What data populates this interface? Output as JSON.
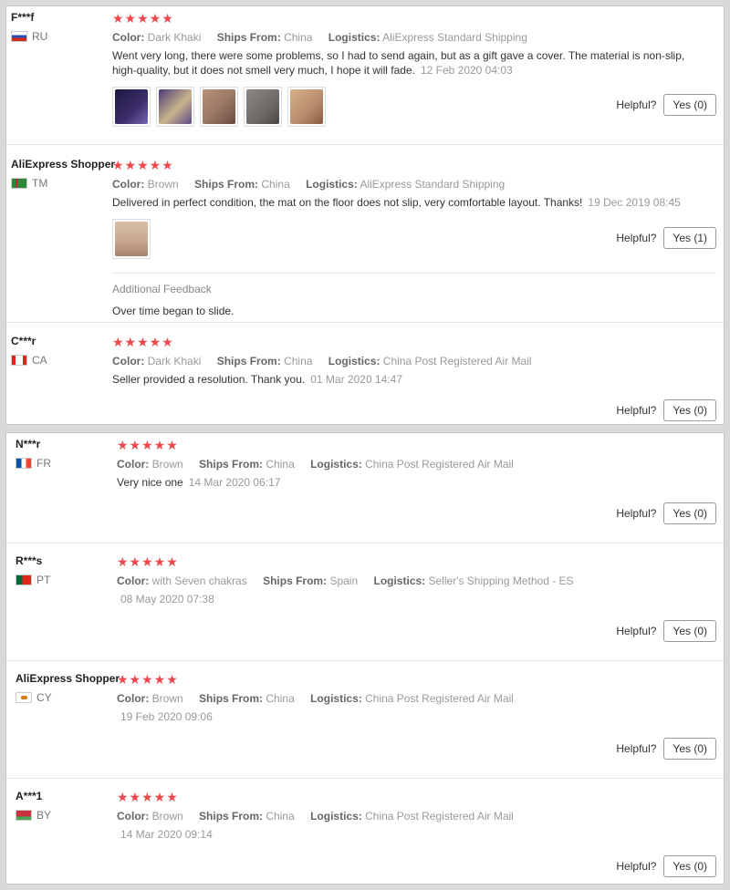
{
  "helpful_label": "Helpful?",
  "stars_text": "★★★★★",
  "labels": {
    "color": "Color:",
    "ships": "Ships From:",
    "logistics": "Logistics:"
  },
  "additional_feedback_title": "Additional Feedback",
  "reviews": [
    {
      "user": "F***f",
      "country": "RU",
      "flag": "russia",
      "color": "Dark Khaki",
      "ships_from": "China",
      "logistics": "AliExpress Standard Shipping",
      "text": "Went very long, there were some problems, so I had to send again, but as a gift gave a cover. The material is non-slip, high-quality, but it does not smell very much, I hope it will fade.",
      "date": "12 Feb 2020 04:03",
      "helpful": "Yes (0)",
      "photos": [
        "#3b2d6b",
        "#5b4a8a",
        "#9b7a66",
        "#6e6a66",
        "#b58a6a"
      ]
    },
    {
      "user": "AliExpress Shopper",
      "country": "TM",
      "flag": "turkmenistan",
      "color": "Brown",
      "ships_from": "China",
      "logistics": "AliExpress Standard Shipping",
      "text": "Delivered in perfect condition, the mat on the floor does not slip, very comfortable layout. Thanks!",
      "date": "19 Dec 2019 08:45",
      "helpful": "Yes (1)",
      "photos": [
        "#c7a58c"
      ],
      "additional_feedback": "Over time began to slide."
    },
    {
      "user": "C***r",
      "country": "CA",
      "flag": "canada",
      "color": "Dark Khaki",
      "ships_from": "China",
      "logistics": "China Post Registered Air Mail",
      "text": "Seller provided a resolution. Thank you.",
      "date": "01 Mar 2020 14:47",
      "helpful": "Yes (0)"
    },
    {
      "user": "N***r",
      "country": "FR",
      "flag": "france",
      "color": "Brown",
      "ships_from": "China",
      "logistics": "China Post Registered Air Mail",
      "text": "Very nice one",
      "date": "14 Mar 2020 06:17",
      "helpful": "Yes (0)"
    },
    {
      "user": "R***s",
      "country": "PT",
      "flag": "portugal",
      "color": "with Seven chakras",
      "ships_from": "Spain",
      "logistics": "Seller's Shipping Method - ES",
      "date": "08 May 2020 07:38",
      "helpful": "Yes (0)"
    },
    {
      "user": "AliExpress Shopper",
      "country": "CY",
      "flag": "cyprus",
      "color": "Brown",
      "ships_from": "China",
      "logistics": "China Post Registered Air Mail",
      "date": "19 Feb 2020 09:06",
      "helpful": "Yes (0)"
    },
    {
      "user": "A***1",
      "country": "BY",
      "flag": "belarus",
      "color": "Brown",
      "ships_from": "China",
      "logistics": "China Post Registered Air Mail",
      "date": "14 Mar 2020 09:14",
      "helpful": "Yes (0)"
    }
  ]
}
